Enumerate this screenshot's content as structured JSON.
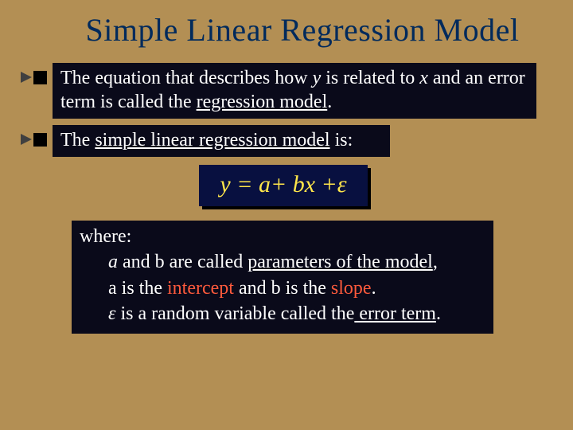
{
  "title": "Simple Linear Regression Model",
  "bullet1": {
    "pre": "The equation that describes how ",
    "y": "y",
    "mid1": " is related to ",
    "x": "x",
    "mid2": " and an error term is called the ",
    "ul": "regression model",
    "end": "."
  },
  "bullet2": {
    "pre": "The ",
    "ul": "simple linear regression model",
    "end": " is:"
  },
  "equation": {
    "y": "y",
    "eq": " = ",
    "a": "a",
    "plus1": "+ b",
    "x": "x",
    "plus2": " +",
    "eps": "ε"
  },
  "where": {
    "label": "where:",
    "line1": {
      "a": "a",
      "mid": " and b are called ",
      "ul": "parameters of the model",
      "end": ","
    },
    "line2": {
      "pre": "a is the ",
      "intercept": "intercept",
      "mid": " and b is the ",
      "slope": "slope",
      "end": "."
    },
    "line3": {
      "eps": "ε",
      "mid": " is a random variable called the",
      "ul": " error term",
      "end": "."
    }
  }
}
